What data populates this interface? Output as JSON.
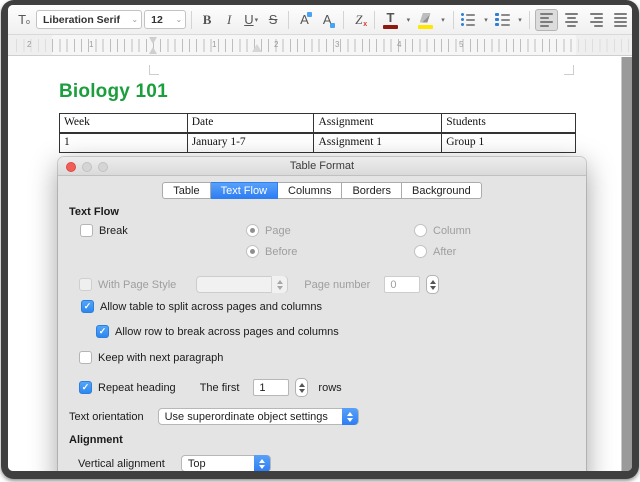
{
  "toolbar": {
    "char_style_glyph": "T",
    "font_name": "Liberation Serif",
    "font_size": "12",
    "bold": "B",
    "italic": "I",
    "underline": "U",
    "strikethrough": "S",
    "superscript": "A",
    "subscript": "A",
    "clear_formatting": "Z",
    "font_color_glyph": "T"
  },
  "ruler": {
    "left_numbers": [
      "2",
      "1"
    ],
    "numbers": [
      "1",
      "2",
      "3",
      "4",
      "5"
    ]
  },
  "document": {
    "heading": "Biology 101",
    "table": {
      "headers": [
        "Week",
        "Date",
        "Assignment",
        "Students"
      ],
      "row1": [
        "1",
        "January 1-7",
        "Assignment 1",
        "Group 1"
      ]
    }
  },
  "dialog": {
    "title": "Table Format",
    "tabs": [
      {
        "label": "Table"
      },
      {
        "label": "Text Flow"
      },
      {
        "label": "Columns"
      },
      {
        "label": "Borders"
      },
      {
        "label": "Background"
      }
    ],
    "text_flow": {
      "section_label": "Text Flow",
      "break_label": "Break",
      "page_label": "Page",
      "column_label": "Column",
      "before_label": "Before",
      "after_label": "After",
      "with_page_style_label": "With Page Style",
      "page_style_value": "",
      "page_number_label": "Page number",
      "page_number_value": "0",
      "allow_table_split_label": "Allow table to split across pages and columns",
      "allow_row_break_label": "Allow row to break across pages and columns",
      "keep_with_next_label": "Keep with next paragraph",
      "repeat_heading_label": "Repeat heading",
      "the_first_label": "The first",
      "repeat_rows_value": "1",
      "rows_label": "rows",
      "text_orientation_label": "Text orientation",
      "text_orientation_value": "Use superordinate object settings"
    },
    "alignment": {
      "section_label": "Alignment",
      "vertical_alignment_label": "Vertical alignment",
      "vertical_alignment_value": "Top"
    },
    "check_glyph": "✓"
  },
  "colors": {
    "accent_blue": "#2e7ef4",
    "heading_green": "#1b9e3c",
    "font_color_red": "#8f1a0e",
    "highlight_yellow": "#ffe600"
  }
}
